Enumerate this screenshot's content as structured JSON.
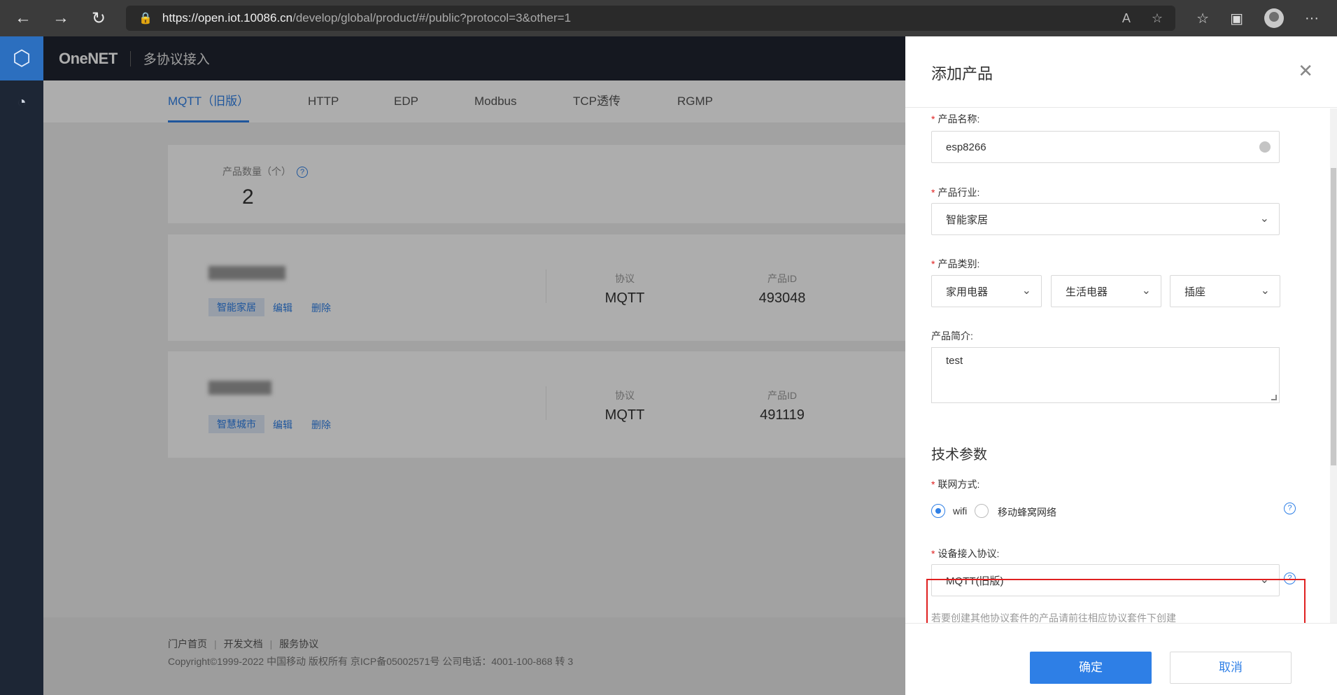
{
  "browser": {
    "url_host": "https://open.iot.10086.cn",
    "url_path": "/develop/global/product/#/public?protocol=3&other=1"
  },
  "app": {
    "logo": "OneNET",
    "title": "多协议接入"
  },
  "tabs": [
    "MQTT（旧版）",
    "HTTP",
    "EDP",
    "Modbus",
    "TCP透传",
    "RGMP"
  ],
  "stats": {
    "label": "产品数量（个）",
    "help": "?",
    "value": "2"
  },
  "products": [
    {
      "tag": "智能家居",
      "edit": "编辑",
      "delete": "删除",
      "protocol_label": "协议",
      "protocol": "MQTT",
      "id_label": "产品ID",
      "id": "493048"
    },
    {
      "tag": "智慧城市",
      "edit": "编辑",
      "delete": "删除",
      "protocol_label": "协议",
      "protocol": "MQTT",
      "id_label": "产品ID",
      "id": "491119"
    }
  ],
  "footer": {
    "links": [
      "门户首页",
      "开发文档",
      "服务协议"
    ],
    "copyright": "Copyright©1999-2022 中国移动 版权所有 京ICP备05002571号 公司电话：4001-100-868 转 3"
  },
  "drawer": {
    "title": "添加产品",
    "name_label": "产品名称:",
    "name_value": "esp8266",
    "industry_label": "产品行业:",
    "industry_value": "智能家居",
    "category_label": "产品类别:",
    "category_values": [
      "家用电器",
      "生活电器",
      "插座"
    ],
    "desc_label": "产品简介:",
    "desc_value": "test",
    "tech_title": "技术参数",
    "network_label": "联网方式:",
    "network_options": [
      "wifi",
      "移动蜂窝网络"
    ],
    "network_selected": "wifi",
    "protocol_label": "设备接入协议:",
    "protocol_value": "MQTT(旧版)",
    "hint": "若要创建其他协议套件的产品请前往相应协议套件下创建",
    "confirm": "确定",
    "cancel": "取消"
  },
  "colors": {
    "accent": "#2e7fe6",
    "required": "#e02020",
    "highlight": "#e02020"
  }
}
